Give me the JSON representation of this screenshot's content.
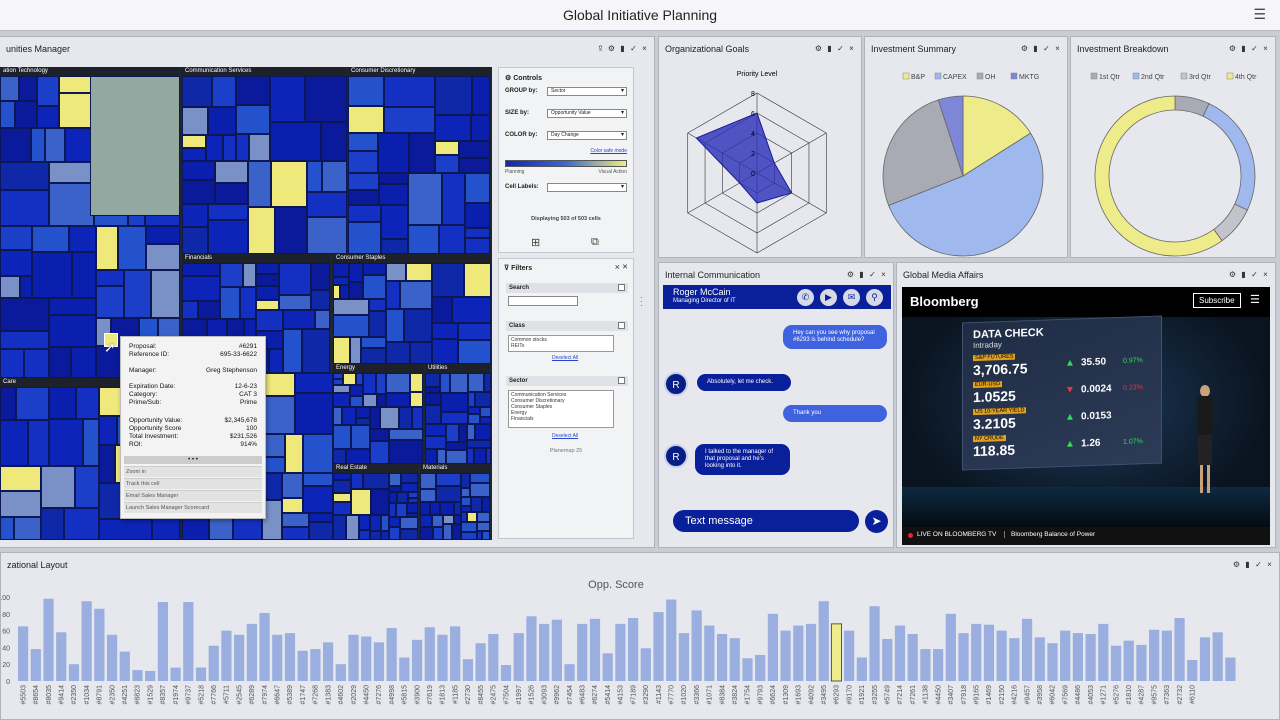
{
  "app": {
    "title": "Global Initiative Planning",
    "menu_icon": "hamburger-icon"
  },
  "panel_buttons": [
    "⇪",
    "⚙",
    "▮",
    "✓",
    "×"
  ],
  "opportunities": {
    "title": "unities Manager",
    "sectors": [
      "ation Technology",
      "Communication Services",
      "Consumer Discretionary",
      "Financials",
      "Consumer Staples",
      "Energy",
      "Utilities",
      "Care",
      "Real Estate",
      "Materials"
    ],
    "tooltip": {
      "rows": [
        [
          "Proposal:",
          "#6291"
        ],
        [
          "Reference ID:",
          "695-33-6622"
        ],
        [
          "Manager:",
          "Greg Stephenson"
        ],
        [
          "Expiration Date:",
          "12-6-23"
        ],
        [
          "Category:",
          "CAT 3"
        ],
        [
          "Prime/Sub:",
          "Prime"
        ],
        [
          "Opportunity Value:",
          "$2,345,678"
        ],
        [
          "Opportunity Score",
          "100"
        ],
        [
          "Total Investment:",
          "$231,526"
        ],
        [
          "ROI:",
          "914%"
        ]
      ],
      "dots": "• • •",
      "actions": [
        "Zoom in",
        "Track this cell",
        "Email Sales Manager",
        "Launch Sales Manager Scorecard"
      ]
    }
  },
  "controls": {
    "title": "Controls",
    "group_label": "GROUP by:",
    "group_value": "Sector",
    "size_label": "SIZE by:",
    "size_value": "Opportunity Value",
    "color_label": "COLOR by:",
    "color_value": "Day Change",
    "color_safe": "Color safe mode",
    "legend_left": "Planning",
    "legend_right": "Visual Action",
    "cell_labels": "Cell Labels:",
    "displaying": "Displaying 503 of 503 cells"
  },
  "filters": {
    "title": "Filters",
    "search_label": "Search",
    "class_label": "Class",
    "class_items": [
      "Common stocks",
      "REITs"
    ],
    "deselect": "Deselect All",
    "sector_label": "Sector",
    "sector_items": [
      "Communication Services",
      "Consumer Discretionary",
      "Consumer Staples",
      "Energy",
      "Financials"
    ],
    "footer": "Planemap 25"
  },
  "goals": {
    "title": "Organizational Goals",
    "axis_label": "Priority Level",
    "ticks": [
      "8",
      "6",
      "4",
      "2",
      "0"
    ],
    "values": [
      6,
      2,
      4,
      3,
      2,
      7
    ]
  },
  "investment_summary": {
    "title": "Investment Summary",
    "legend": [
      "B&P",
      "CAPEX",
      "OH",
      "MKTG"
    ],
    "colors": [
      "#eeeb8a",
      "#9fb8ee",
      "#a9abb4",
      "#7e86d8"
    ],
    "values": [
      16,
      53,
      26,
      5
    ]
  },
  "investment_breakdown": {
    "title": "Investment Breakdown",
    "legend": [
      "1st Qtr",
      "2nd Qtr",
      "3rd Qtr",
      "4th Qtr"
    ],
    "colors": [
      "#a9abb4",
      "#9fb8ee",
      "#c2c4ca",
      "#eeeb8a"
    ],
    "values": [
      7,
      25,
      8,
      60
    ]
  },
  "chat": {
    "title": "Internal Communication",
    "contact_name": "Roger McCain",
    "contact_role": "Managing Director of IT",
    "avatar_letter": "R",
    "messages": [
      "Hey can you see why proposal #6293 is behind schedule?",
      "Absolutely, let me check.",
      "Thank you",
      "I talked to the manager of that proposal and he's looking into it."
    ],
    "input_placeholder": "Text message"
  },
  "media": {
    "title": "Global Media Affairs",
    "brand": "Bloomberg",
    "subscribe": "Subscribe",
    "board_title": "DATA CHECK",
    "board_sub": "Intraday",
    "quotes": [
      [
        "S&P FUTURES",
        "3,706.75",
        "▲",
        "35.50",
        "0.97%"
      ],
      [
        "EUR-USD",
        "1.0525",
        "▼",
        "0.0024",
        "0.23%"
      ],
      [
        "US 10-YEAR YIELD",
        "3.2105",
        "▲",
        "0.0153",
        ""
      ],
      [
        "NY CRUDE",
        "118.85",
        "▲",
        "1.26",
        "1.07%"
      ]
    ],
    "live": "LIVE ON BLOOMBERG TV",
    "show": "Bloomberg Balance of Power"
  },
  "chart_data": {
    "type": "bar",
    "title": "Opp. Score",
    "panel_title": "zational Layout",
    "ylim": [
      0,
      100
    ],
    "yticks": [
      "100",
      "80",
      "60",
      "40",
      "20",
      "0"
    ],
    "highlight_color": "#eeeb8a",
    "bar_color": "#9aaee0",
    "categories": [
      "#5503",
      "#8654",
      "#8035",
      "#9414",
      "#2350",
      "#1034",
      "#8791",
      "#2350",
      "#4251",
      "#8823",
      "#1529",
      "#8357",
      "#1974",
      "#9737",
      "#5218",
      "#7766",
      "#5711",
      "#2545",
      "#6289",
      "#7974",
      "#6647",
      "#5389",
      "#1747",
      "#7268",
      "#1383",
      "#4602",
      "#2029",
      "#4450",
      "#7276",
      "#4998",
      "#5815",
      "#3900",
      "#7619",
      "#1813",
      "#1185",
      "#2730",
      "#8455",
      "#2475",
      "#7504",
      "#1997",
      "#1526",
      "#3093",
      "#9962",
      "#7454",
      "#6483",
      "#6274",
      "#5414",
      "#4153",
      "#7189",
      "#3290",
      "#1143",
      "#7770",
      "#1020",
      "#3366",
      "#1071",
      "#8384",
      "#3824",
      "#1754",
      "#9793",
      "#6624",
      "#1309",
      "#1693",
      "#4092",
      "#3495",
      "#6293",
      "#9170",
      "#1921",
      "#3255",
      "#5749",
      "#7214",
      "#7261",
      "#1138",
      "#4450",
      "#3407",
      "#7918",
      "#9165",
      "#1469",
      "#2150",
      "#4216",
      "#9457",
      "#3958",
      "#6042",
      "#7569",
      "#4486",
      "#4053",
      "#1271",
      "#5276",
      "#1810",
      "#4287",
      "#9575",
      "#7363",
      "#2732",
      "#6110"
    ],
    "values": [
      65,
      38,
      98,
      58,
      20,
      95,
      86,
      55,
      35,
      13,
      12,
      94,
      16,
      94,
      16,
      42,
      60,
      55,
      68,
      81,
      55,
      57,
      36,
      38,
      46,
      20,
      55,
      53,
      46,
      63,
      28,
      49,
      64,
      55,
      65,
      26,
      45,
      56,
      19,
      57,
      77,
      68,
      73,
      20,
      68,
      74,
      33,
      68,
      75,
      39,
      82,
      97,
      57,
      84,
      66,
      56,
      51,
      27,
      31,
      80,
      60,
      66,
      68,
      95,
      68,
      60,
      28,
      89,
      50,
      66,
      56,
      38,
      38,
      80,
      57,
      68,
      67,
      60,
      51,
      74,
      52,
      45,
      60,
      57,
      56,
      68,
      42,
      48,
      43,
      61,
      60,
      75,
      25,
      52,
      58,
      28
    ],
    "highlight_index": 64
  }
}
